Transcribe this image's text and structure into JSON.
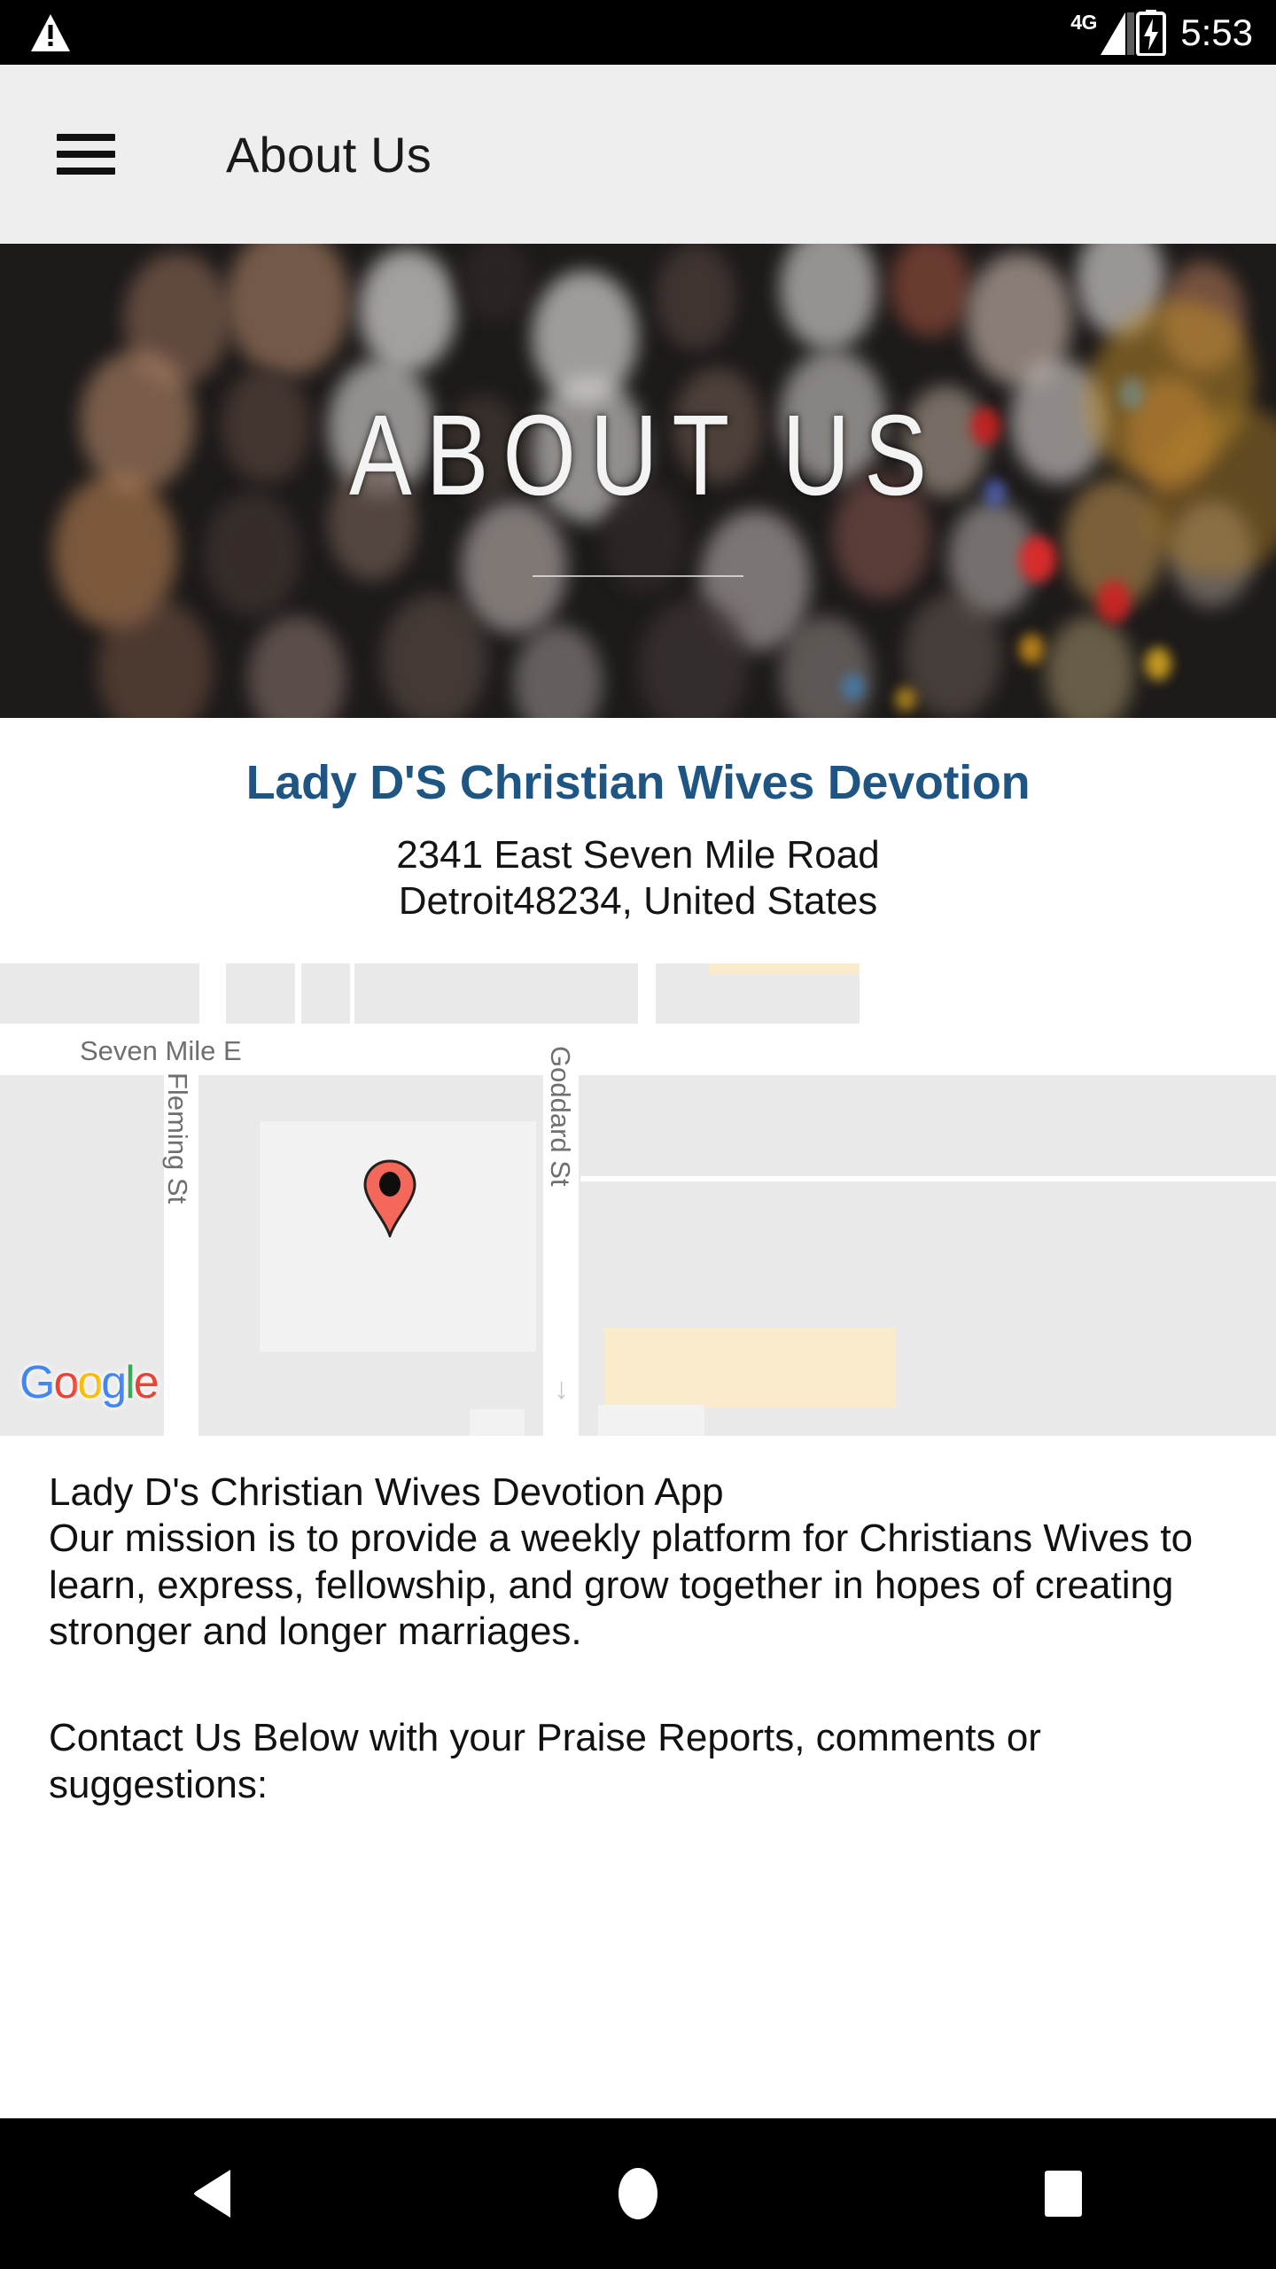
{
  "status_bar": {
    "warning_icon": "warning-triangle-icon",
    "network_label": "4G",
    "signal_icon": "signal-bars-icon",
    "battery_icon": "battery-charging-icon",
    "time": "5:53"
  },
  "app_bar": {
    "menu_icon": "hamburger-menu-icon",
    "title": "About Us"
  },
  "hero": {
    "title": "ABOUT US"
  },
  "org": {
    "name": "Lady D'S Christian Wives Devotion",
    "address_line1": "2341 East Seven Mile Road",
    "address_line2": "Detroit48234, United States"
  },
  "map": {
    "street_horizontal": "Seven Mile E",
    "street_left": "Fleming St",
    "street_right": "Goddard St",
    "marker_icon": "map-pin-icon",
    "attribution": {
      "g1": "G",
      "o1": "o",
      "o2": "o",
      "g2": "g",
      "l": "l",
      "e": "e"
    },
    "oneway_arrow_icon": "arrow-down-icon"
  },
  "content": {
    "paragraph1": "Lady D's Christian Wives Devotion App\nOur mission is to provide a weekly platform for Christians Wives to learn, express, fellowship, and grow together in hopes of creating stronger and longer marriages.",
    "paragraph2": "Contact Us Below with your Praise Reports, comments or suggestions:"
  },
  "nav_bar": {
    "back_icon": "back-triangle-icon",
    "home_icon": "home-circle-icon",
    "recents_icon": "recents-square-icon"
  },
  "colors": {
    "accent": "#1f5582",
    "app_bar_bg": "#eeeeee",
    "hero_bg": "#1d1a1a",
    "pin": "#f4685b"
  }
}
